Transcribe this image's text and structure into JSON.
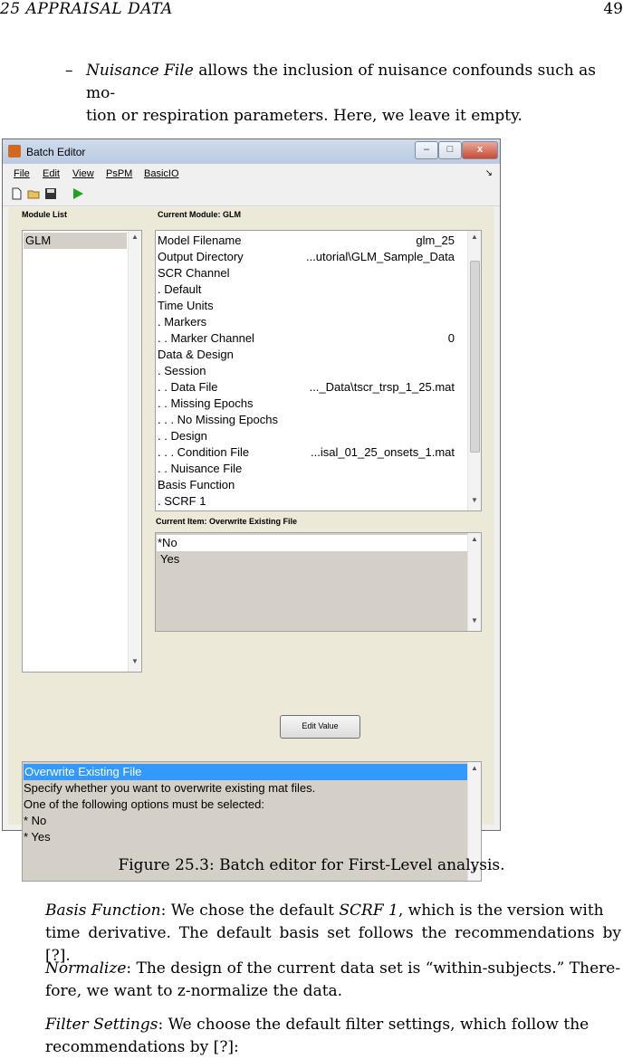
{
  "page": {
    "chapter": "25   APPRAISAL DATA",
    "number": "49"
  },
  "bullet": {
    "marker": "–",
    "term": "Nuisance File",
    "text1": " allows the inclusion of nuisance confounds such as mo-",
    "text2": "tion or respiration parameters. Here, we leave it empty."
  },
  "window": {
    "title": "Batch Editor",
    "menus": [
      "File",
      "Edit",
      "View",
      "PsPM",
      "BasicIO"
    ],
    "min_btn": "–",
    "max_btn": "□",
    "close_btn": "x",
    "module_list_label": "Module List",
    "current_module_label": "Current Module: GLM",
    "modules": [
      "GLM"
    ],
    "items": [
      {
        "label": "Model Filename",
        "value": "glm_25"
      },
      {
        "label": "Output Directory",
        "value": "...utorial\\GLM_Sample_Data"
      },
      {
        "label": "SCR Channel",
        "value": ""
      },
      {
        "label": ". Default",
        "value": ""
      },
      {
        "label": "Time Units",
        "value": ""
      },
      {
        "label": ". Markers",
        "value": ""
      },
      {
        "label": ". . Marker Channel",
        "value": "0"
      },
      {
        "label": "Data & Design",
        "value": ""
      },
      {
        "label": ". Session",
        "value": ""
      },
      {
        "label": ". . Data File",
        "value": "..._Data\\tscr_trsp_1_25.mat"
      },
      {
        "label": ". . Missing Epochs",
        "value": ""
      },
      {
        "label": ". . . No Missing Epochs",
        "value": ""
      },
      {
        "label": ". . Design",
        "value": ""
      },
      {
        "label": ". . . Condition File",
        "value": "...isal_01_25_onsets_1.mat"
      },
      {
        "label": ". . Nuisance File",
        "value": ""
      },
      {
        "label": "Basis Function",
        "value": ""
      },
      {
        "label": ". SCRF 1",
        "value": ""
      }
    ],
    "current_item_label": "Current Item: Overwrite Existing File",
    "options": [
      "*No",
      "Yes"
    ],
    "edit_button": "Edit Value",
    "help": [
      "Overwrite Existing File",
      "Specify whether you want to overwrite existing mat files.",
      "One of the following options must be selected:",
      "* No",
      "* Yes"
    ]
  },
  "caption": "Figure 25.3: Batch editor for First-Level analysis.",
  "paragraphs": [
    {
      "term": "Basis Function",
      "sep": ": We chose the default ",
      "term2": "SCRF 1",
      "rest1": ", which is the version with",
      "rest2": "time derivative. The default basis set follows the recommendations by [?]."
    },
    {
      "term": "Normalize",
      "line1": ": The design of the current data set is “within-subjects.” There-",
      "line2": "fore, we want to z-normalize the data."
    },
    {
      "term": "Filter Settings",
      "line1": ": We choose the default filter settings, which follow the",
      "line2": "recommendations by [?]:"
    }
  ]
}
